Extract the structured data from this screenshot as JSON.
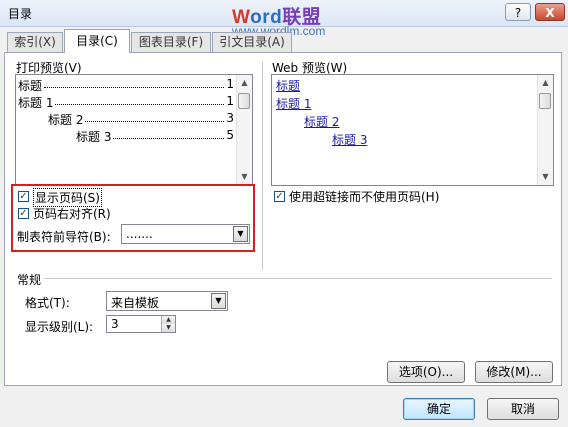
{
  "window": {
    "title": "目录",
    "help_label": "?",
    "close_label": "X"
  },
  "watermark": {
    "w": "W",
    "ord": "ord",
    "cn": "联盟",
    "url": "www.wordlm.com"
  },
  "tabs": [
    {
      "label": "索引(X)",
      "active": false
    },
    {
      "label": "目录(C)",
      "active": true
    },
    {
      "label": "图表目录(F)",
      "active": false
    },
    {
      "label": "引文目录(A)",
      "active": false
    }
  ],
  "print_preview": {
    "label": "打印预览(V)",
    "lines": [
      {
        "text": "标题",
        "page": "1",
        "level": 0
      },
      {
        "text": "标题  1",
        "page": "1",
        "level": 0
      },
      {
        "text": "标题  2",
        "page": "3",
        "level": 1
      },
      {
        "text": "标题  3",
        "page": "5",
        "level": 2
      }
    ]
  },
  "web_preview": {
    "label": "Web 预览(W)",
    "links": [
      "标题",
      "标题 1",
      "标题 2",
      "标题 3"
    ]
  },
  "options": {
    "show_page_numbers": {
      "label": "显示页码(S)",
      "checked": true
    },
    "right_align": {
      "label": "页码右对齐(R)",
      "checked": true
    },
    "tab_leader": {
      "label": "制表符前导符(B):",
      "value": "......."
    },
    "use_hyperlinks": {
      "label": "使用超链接而不使用页码(H)",
      "checked": true
    }
  },
  "general": {
    "label": "常规",
    "format_label": "格式(T):",
    "format_value": "来自模板",
    "levels_label": "显示级别(L):",
    "levels_value": "3"
  },
  "buttons": {
    "options": "选项(O)...",
    "modify": "修改(M)...",
    "ok": "确定",
    "cancel": "取消"
  },
  "icons": {
    "check": "✓",
    "dropdown": "▼",
    "scroll_up": "▲",
    "scroll_down": "▼",
    "spin_up": "▲",
    "spin_down": "▼"
  }
}
